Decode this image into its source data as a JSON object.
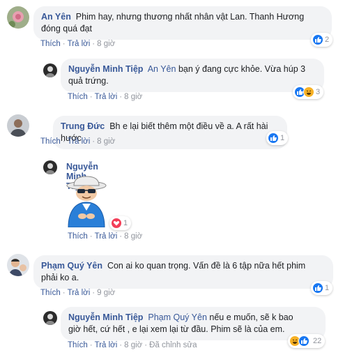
{
  "comments": [
    {
      "author": "An Yên",
      "text": "Phim hay, nhưng thương nhất nhân vật Lan. Thanh Hương",
      "text2": "đóng quá đạt",
      "like_label": "Thích",
      "reply_label": "Trả lời",
      "time": "8 giờ",
      "reaction_count": "2"
    },
    {
      "author": "Nguyễn Minh Tiệp",
      "mention": "An Yên",
      "text": "bạn ý đang cực khỏe. Vừa húp 3",
      "text2": "quả trứng.",
      "like_label": "Thích",
      "reply_label": "Trả lời",
      "time": "8 giờ",
      "reaction_count": "3"
    },
    {
      "author": "Trung Đức",
      "text": "Bh e lại biết thêm một điều về a. A rất hài hước",
      "like_label": "Thích",
      "reply_label": "Trả lời",
      "time": "8 giờ",
      "reaction_count": "1"
    },
    {
      "author": "Nguyễn Minh Tiệp",
      "sticker": "sticker-old-man-glasses",
      "like_label": "Thích",
      "reply_label": "Trả lời",
      "time": "8 giờ",
      "reaction_count": "1"
    },
    {
      "author": "Phạm Quý Yên",
      "text": "Con ai ko quan trọng. Vấn đề là 6 tập nữa hết phim",
      "text2": "phải ko a.",
      "like_label": "Thích",
      "reply_label": "Trả lời",
      "time": "9 giờ",
      "reaction_count": "1"
    },
    {
      "author": "Nguyễn Minh Tiệp",
      "mention": "Phạm Quý Yên",
      "text": "nếu e muốn, sẽ k bao",
      "text2": "giờ hết, cứ hết , e lại xem lại từ đầu. Phim sẽ là của em.",
      "like_label": "Thích",
      "reply_label": "Trả lời",
      "time": "8 giờ",
      "edited_label": "Đã chỉnh sửa",
      "reaction_count": "22"
    }
  ],
  "colors": {
    "link": "#385898",
    "bubble": "#f2f3f5",
    "like": "#1877f2",
    "love": "#f33e58",
    "haha": "#f7b125"
  }
}
